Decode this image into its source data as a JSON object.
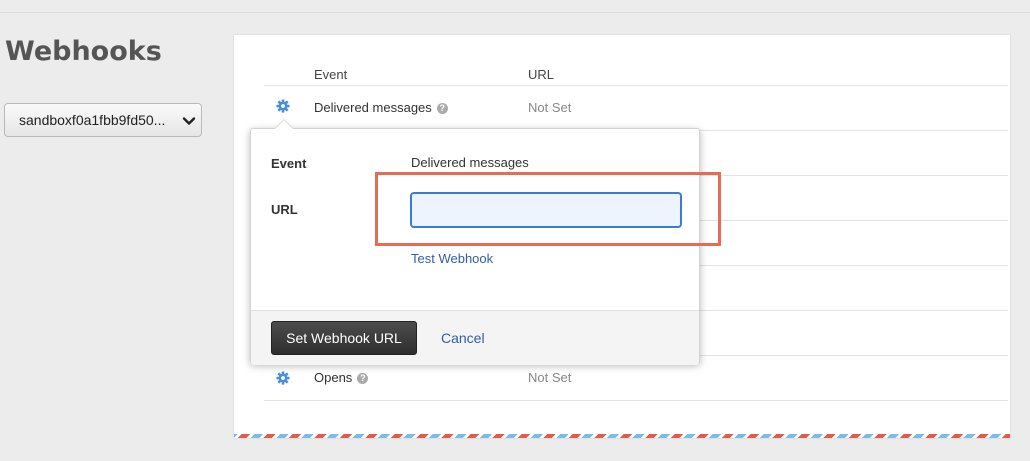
{
  "page": {
    "title": "Webhooks"
  },
  "domain_select": {
    "value": "sandboxf0a1fbb9fd50..."
  },
  "table": {
    "headers": {
      "event": "Event",
      "url": "URL"
    },
    "rows": [
      {
        "event": "Delivered messages",
        "url": "Not Set"
      },
      {
        "event": "Opens",
        "url": "Not Set"
      }
    ]
  },
  "popover": {
    "event_label": "Event",
    "event_value": "Delivered messages",
    "url_label": "URL",
    "url_value": "",
    "test_link": "Test Webhook",
    "submit_label": "Set Webhook URL",
    "cancel_label": "Cancel"
  },
  "icons": {
    "row_settings": "gear-icon",
    "help": "question-icon",
    "dropdown": "chevron-down-icon"
  },
  "colors": {
    "accent_blue": "#3a7bd5",
    "gear_blue": "#4a90d9",
    "link_blue": "#2f5fa8",
    "highlight": "#e86b55",
    "dark_button": "#333333"
  }
}
